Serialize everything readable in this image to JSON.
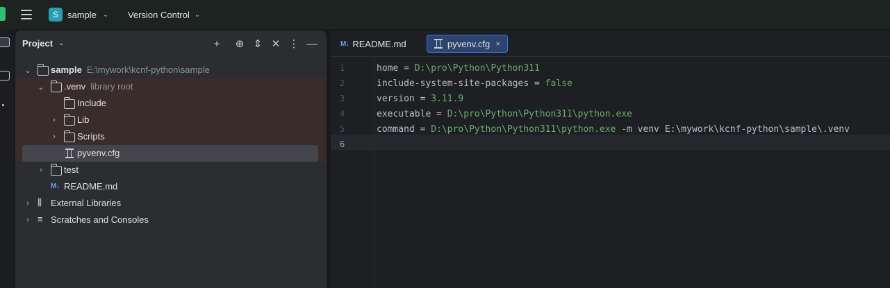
{
  "titlebar": {
    "project_badge": "S",
    "project_name": "sample",
    "vcs_label": "Version Control"
  },
  "project_panel": {
    "title": "Project",
    "tree": [
      {
        "name": "sample",
        "hint": "E:\\mywork\\kcnf-python\\sample",
        "kind": "module-root",
        "depth": 0,
        "expanded": true
      },
      {
        "name": ".venv",
        "hint": "library root",
        "kind": "folder",
        "depth": 1,
        "expanded": true
      },
      {
        "name": "Include",
        "hint": "",
        "kind": "folder",
        "depth": 2,
        "expanded": null
      },
      {
        "name": "Lib",
        "hint": "",
        "kind": "folder",
        "depth": 2,
        "expanded": false
      },
      {
        "name": "Scripts",
        "hint": "",
        "kind": "folder",
        "depth": 2,
        "expanded": false
      },
      {
        "name": "pyvenv.cfg",
        "hint": "",
        "kind": "cfg-file",
        "depth": 2,
        "expanded": null,
        "selected": true
      },
      {
        "name": "test",
        "hint": "",
        "kind": "folder",
        "depth": 1,
        "expanded": false
      },
      {
        "name": "README.md",
        "hint": "",
        "kind": "md-file",
        "depth": 1,
        "expanded": null
      },
      {
        "name": "External Libraries",
        "hint": "",
        "kind": "libraries",
        "depth": 0,
        "expanded": false
      },
      {
        "name": "Scratches and Consoles",
        "hint": "",
        "kind": "scratches",
        "depth": 0,
        "expanded": false
      }
    ]
  },
  "editor": {
    "tabs": [
      {
        "label": "README.md",
        "icon": "M↓",
        "active": false
      },
      {
        "label": "pyvenv.cfg",
        "icon": "cfg-file-icon",
        "active": true
      }
    ],
    "lines": [
      {
        "num": "1",
        "key": "home = ",
        "value": "D:\\pro\\Python\\Python311",
        "rest": ""
      },
      {
        "num": "2",
        "key": "include-system-site-packages = ",
        "value": "false",
        "rest": ""
      },
      {
        "num": "3",
        "key": "version = ",
        "value": "3.11.9",
        "rest": ""
      },
      {
        "num": "4",
        "key": "executable = ",
        "value": "D:\\pro\\Python\\Python311\\python.exe",
        "rest": ""
      },
      {
        "num": "5",
        "key": "command = ",
        "value": "D:\\pro\\Python\\Python311\\python.exe",
        "rest": " -m venv E:\\mywork\\kcnf-python\\sample\\.venv"
      },
      {
        "num": "6",
        "key": "",
        "value": "",
        "rest": ""
      }
    ],
    "current_line": "6"
  },
  "colors": {
    "accent": "#3574f0",
    "value_green": "#6aab73",
    "venv_highlight": "#3a2c2b",
    "project_badge": "#2b9fb2"
  }
}
